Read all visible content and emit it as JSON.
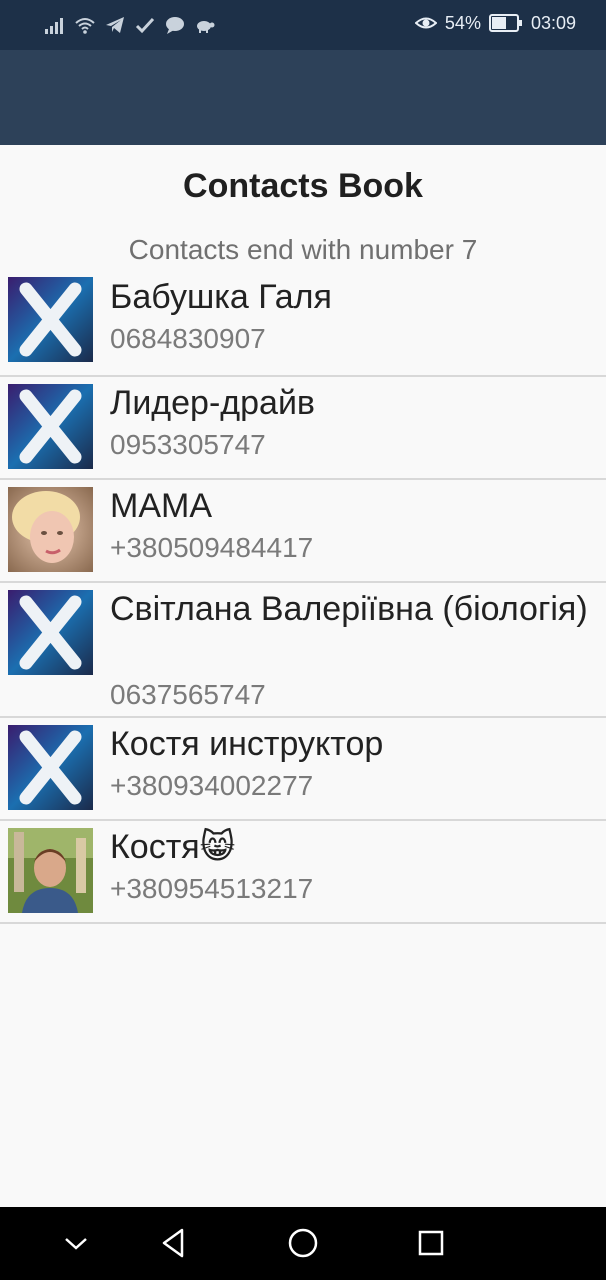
{
  "status_bar": {
    "battery": "54%",
    "time": "03:09",
    "icons": [
      "signal-icon",
      "wifi-icon",
      "telegram-icon",
      "check-icon",
      "chat-icon",
      "turtle-icon",
      "eye-icon",
      "battery-icon"
    ]
  },
  "page": {
    "title": "Contacts Book",
    "subtitle": "Contacts end with number 7"
  },
  "contacts": [
    {
      "name": "Бабушка Галя",
      "phone": "0684830907",
      "avatar": "default-x-avatar"
    },
    {
      "name": "Лидер-драйв",
      "phone": "0953305747",
      "avatar": "default-x-avatar"
    },
    {
      "name": "МАМА",
      "phone": "+380509484417",
      "avatar": "photo-avatar-woman"
    },
    {
      "name": "Світлана Валеріївна (біологія)",
      "phone": "0637565747",
      "avatar": "default-x-avatar"
    },
    {
      "name": "Костя инструктор",
      "phone": "+380934002277",
      "avatar": "default-x-avatar"
    },
    {
      "name": "Костя😸",
      "phone": "+380954513217",
      "avatar": "photo-avatar-man"
    }
  ],
  "nav_bar": {
    "icons": [
      "chevron-down-icon",
      "back-icon",
      "home-icon",
      "recents-icon"
    ]
  },
  "colors": {
    "status_bar": "#1d3048",
    "app_bar": "#2d4159",
    "background": "#f9f9f9",
    "divider": "#d8d8d8"
  }
}
